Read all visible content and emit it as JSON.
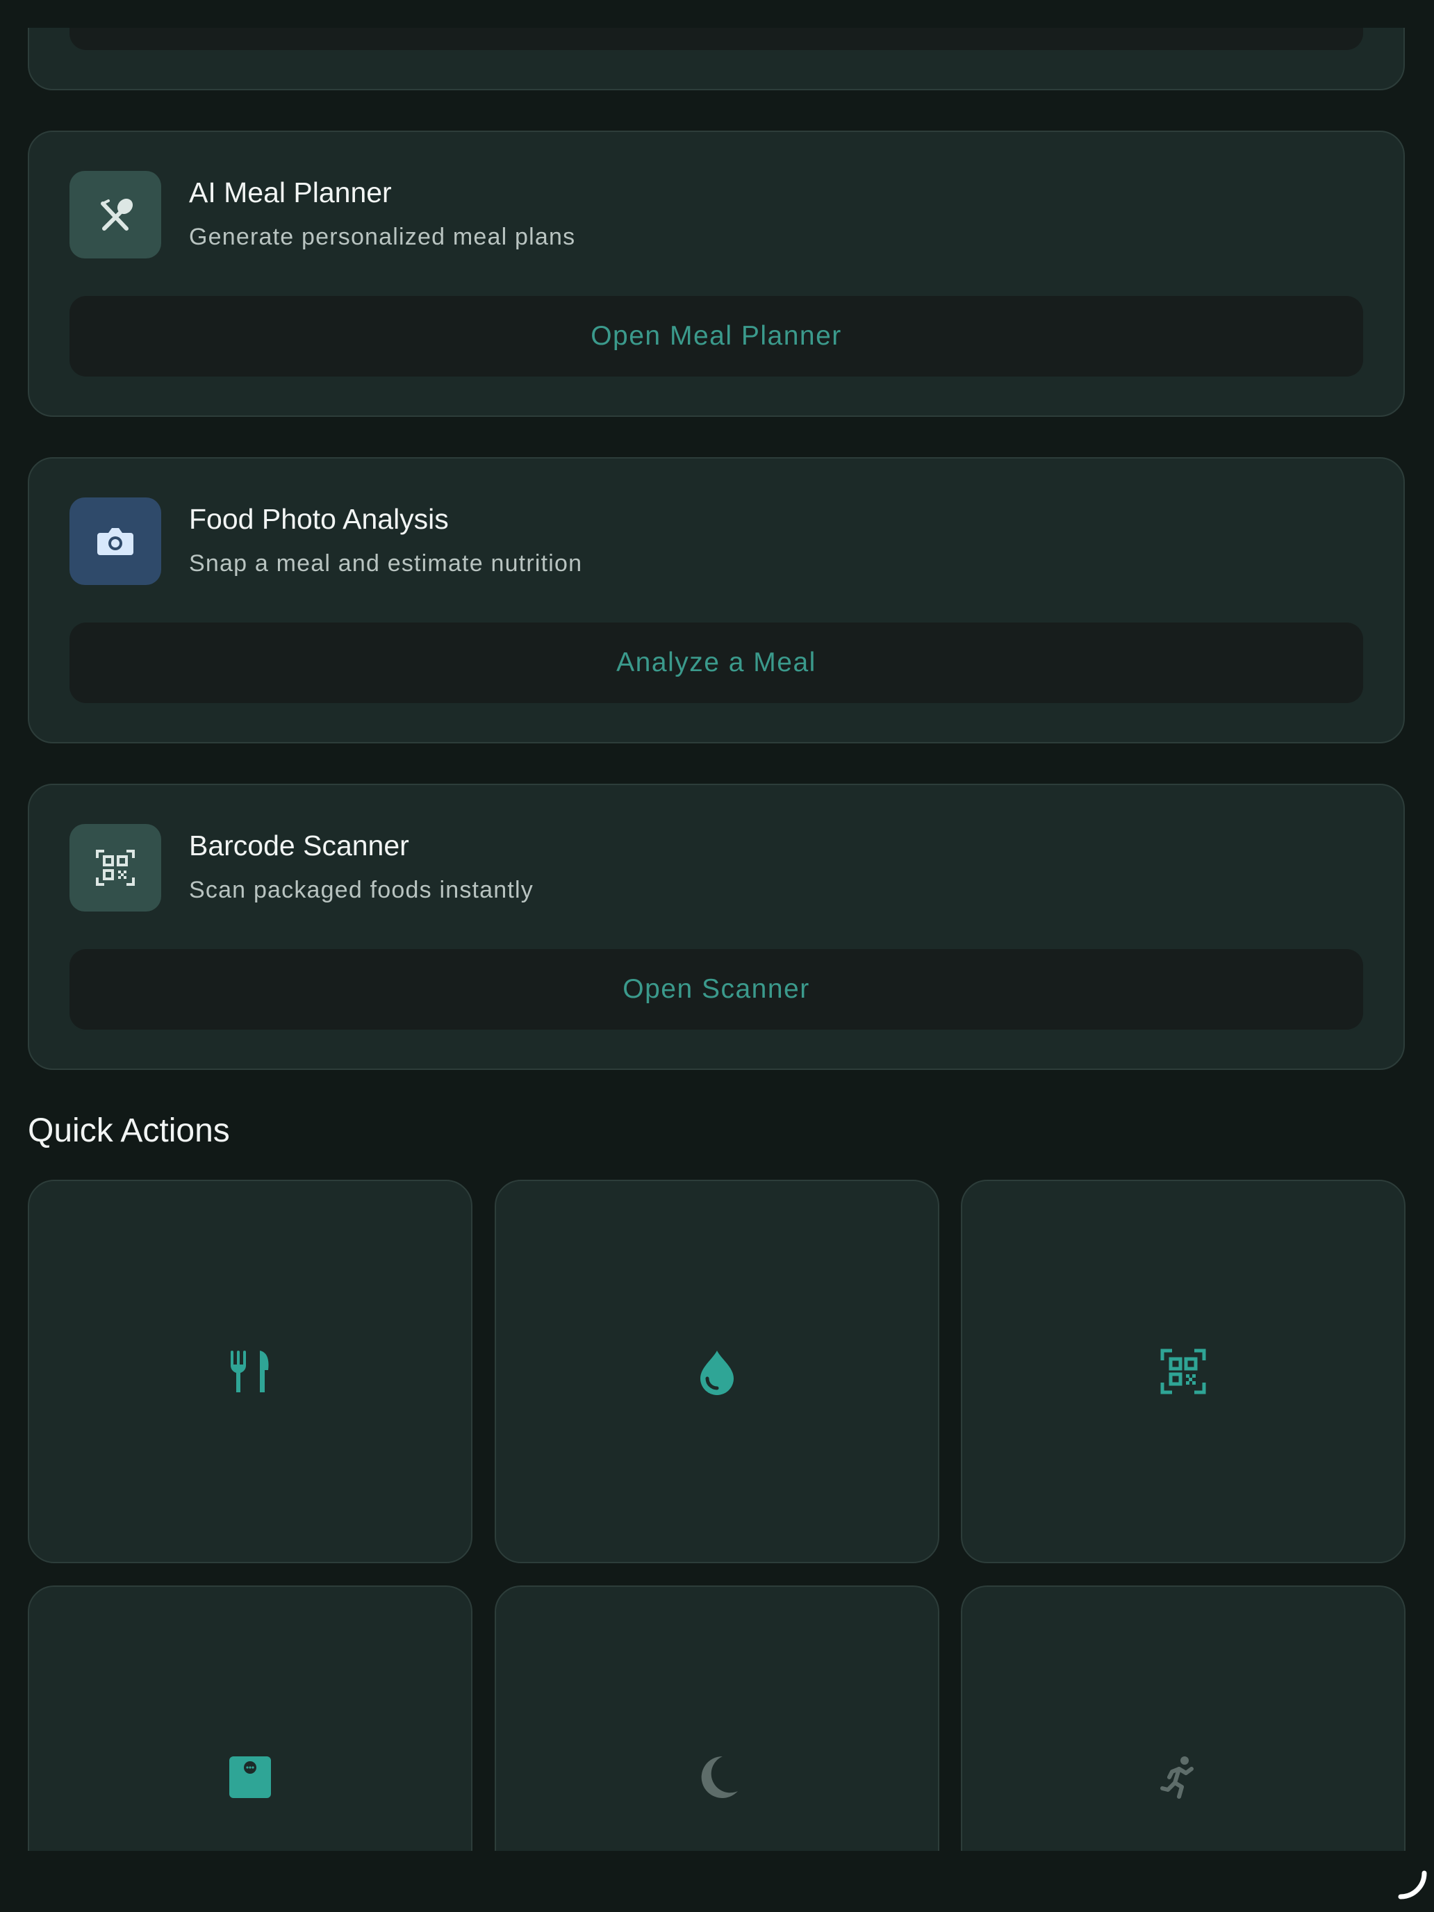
{
  "colors": {
    "background": "#111917",
    "card": "#1c2a28",
    "button": "#171d1c",
    "accent": "#3b9a8c",
    "accent_bright": "#2fa596",
    "muted_icon": "#5e6d6a"
  },
  "feature_cards": [
    {
      "icon": "fork-spoon-cross-icon",
      "title": "AI Meal Planner",
      "description": "Generate personalized meal plans",
      "button_label": "Open Meal Planner"
    },
    {
      "icon": "camera-icon",
      "title": "Food Photo Analysis",
      "description": "Snap a meal and estimate nutrition",
      "button_label": "Analyze a Meal"
    },
    {
      "icon": "qr-scan-icon",
      "title": "Barcode Scanner",
      "description": "Scan packaged foods instantly",
      "button_label": "Open Scanner"
    }
  ],
  "quick_actions": {
    "title": "Quick Actions",
    "items": [
      {
        "icon": "fork-knife-icon"
      },
      {
        "icon": "water-drop-icon"
      },
      {
        "icon": "qr-scan-icon"
      },
      {
        "icon": "weight-scale-icon"
      },
      {
        "icon": "moon-icon"
      },
      {
        "icon": "running-person-icon"
      }
    ]
  }
}
